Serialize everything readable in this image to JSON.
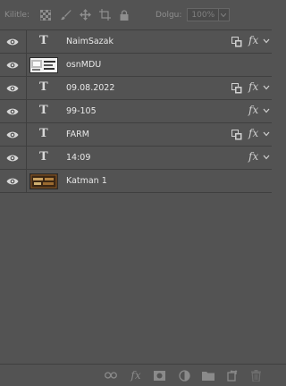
{
  "lockbar": {
    "lock_label": "Kilitle:",
    "fill_label": "Dolgu:",
    "fill_value": "100%"
  },
  "layers": [
    {
      "name": "NaimSazak",
      "kind": "text",
      "smart_icon": true,
      "fx": "fx"
    },
    {
      "name": "osnMDU",
      "kind": "image",
      "smart_icon": false,
      "fx": ""
    },
    {
      "name": "09.08.2022",
      "kind": "text",
      "smart_icon": true,
      "fx": "fx"
    },
    {
      "name": "99-105",
      "kind": "text",
      "smart_icon": false,
      "fx": "fx"
    },
    {
      "name": "FARM",
      "kind": "text",
      "smart_icon": true,
      "fx": "fx"
    },
    {
      "name": "14:09",
      "kind": "text",
      "smart_icon": false,
      "fx": "fx"
    },
    {
      "name": "Katman 1",
      "kind": "photo",
      "smart_icon": false,
      "fx": ""
    }
  ],
  "text_glyph": "T",
  "bottom": {
    "fx_label": "fx"
  },
  "colors": {
    "panel_bg": "#535353",
    "row_border": "#3f3f3f",
    "text": "#e8e8e8",
    "muted": "#8e8e8e"
  }
}
